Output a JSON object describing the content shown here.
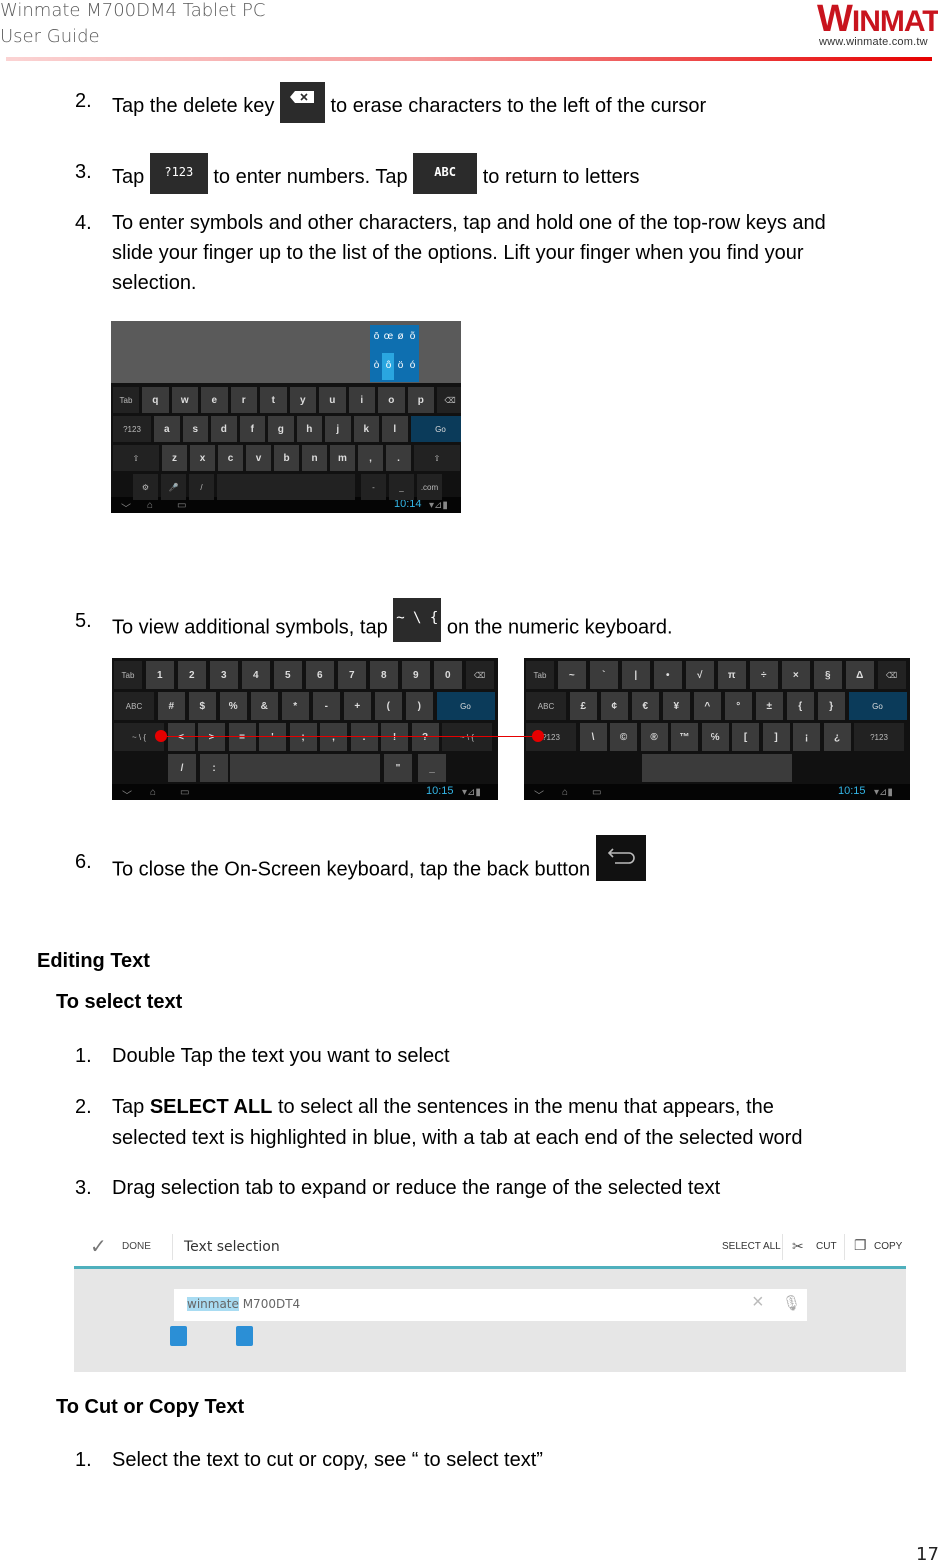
{
  "header": {
    "doc_title_line1": "Winmate M700DM4 Tablet PC",
    "doc_title_line2": "User Guide",
    "logo_text_w": "W",
    "logo_text_rest": "INMATE",
    "logo_url": "www.winmate.com.tw",
    "accent_color": "#e60000"
  },
  "steps_top": [
    {
      "num": "2.",
      "before": "Tap the delete key",
      "key": "⌫",
      "after": "to erase characters to the left of the cursor"
    },
    {
      "num": "3.",
      "before": "Tap",
      "key1": "?123",
      "middle": "to enter numbers. Tap",
      "key2": "ABC",
      "after": "to return to letters"
    },
    {
      "num": "4.",
      "line1": "To enter symbols and other characters, tap and hold one of the top-row keys and",
      "line2": "slide your finger up to the list of the options. Lift your finger when you find your",
      "line3": "selection."
    },
    {
      "num": "5.",
      "before": "To view additional symbols, tap",
      "key": "~ \\ {",
      "after": "on the numeric keyboard."
    },
    {
      "num": "6.",
      "before": "To close the On-Screen keyboard, tap the back button",
      "key": "↩"
    }
  ],
  "keyboard_alpha": {
    "popup_row1": [
      "ō",
      "œ",
      "ø",
      "õ"
    ],
    "popup_row2": [
      "ò",
      "ô",
      "ö",
      "ó"
    ],
    "row1": [
      "Tab",
      "q",
      "w",
      "e",
      "r",
      "t",
      "y",
      "u",
      "i",
      "o",
      "p",
      "⌫"
    ],
    "row2": [
      "?123",
      "a",
      "s",
      "d",
      "f",
      "g",
      "h",
      "j",
      "k",
      "l",
      "Go"
    ],
    "row3": [
      "⇧",
      "z",
      "x",
      "c",
      "v",
      "b",
      "n",
      "m",
      ",",
      ".",
      "⇧"
    ],
    "row4": [
      "⚙",
      "🎤",
      "/",
      "",
      "-",
      "_",
      ".com"
    ],
    "time": "10:14"
  },
  "keyboard_numeric": {
    "row1": [
      "Tab",
      "1",
      "2",
      "3",
      "4",
      "5",
      "6",
      "7",
      "8",
      "9",
      "0",
      "⌫"
    ],
    "row2": [
      "ABC",
      "#",
      "$",
      "%",
      "&",
      "*",
      "-",
      "+",
      "(",
      ")",
      "Go"
    ],
    "row3": [
      "~ \\ {",
      "<",
      ">",
      "=",
      "'",
      ";",
      ",",
      ".",
      "!",
      "?",
      "~ \\ {"
    ],
    "row4": [
      "/",
      ":",
      "",
      "\"",
      "_"
    ],
    "time": "10:15"
  },
  "keyboard_symbols": {
    "row1": [
      "Tab",
      "~",
      "`",
      "|",
      "•",
      "√",
      "π",
      "÷",
      "×",
      "§",
      "Δ",
      "⌫"
    ],
    "row2": [
      "ABC",
      "£",
      "¢",
      "€",
      "¥",
      "^",
      "°",
      "±",
      "{",
      "}",
      "Go"
    ],
    "row3": [
      "?123",
      "\\",
      "©",
      "®",
      "™",
      "℅",
      "[",
      "]",
      "¡",
      "¿",
      "?123"
    ],
    "row4": [
      ""
    ],
    "time": "10:15"
  },
  "editing": {
    "heading": "Editing Text",
    "select_heading": "To select text",
    "steps": [
      {
        "num": "1.",
        "text": "Double Tap the text you want to select"
      },
      {
        "num": "2.",
        "before": "Tap ",
        "bold": "SELECT ALL",
        "after": " to select all the sentences in the menu that appears, the",
        "line2": "selected text is highlighted in blue, with a tab at each end of the selected word"
      },
      {
        "num": "3.",
        "text": "Drag selection tab to expand or reduce the range of the selected text"
      }
    ],
    "screenshot": {
      "done_label": "DONE",
      "title": "Text selection",
      "select_all": "SELECT ALL",
      "cut": "CUT",
      "copy": "COPY",
      "selected_text": "winmate",
      "rest_text": " M700DT4"
    },
    "cut_copy_heading": "To Cut or Copy Text",
    "cut_copy_steps": [
      {
        "num": "1.",
        "text": "Select the text to cut or copy, see “ to select text”"
      }
    ]
  },
  "page_number": "17"
}
